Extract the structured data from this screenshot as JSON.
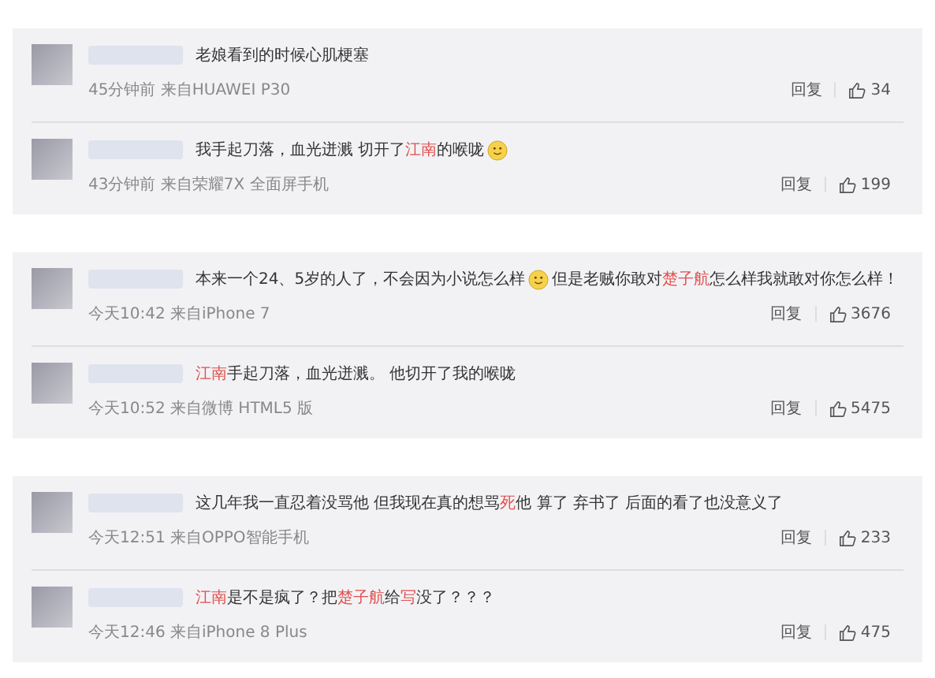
{
  "cards": [
    {
      "comments": [
        {
          "segments": [
            {
              "kind": "text",
              "text": "老娘看到的时候心肌梗塞"
            }
          ],
          "meta": "45分钟前 来自HUAWEI P30",
          "reply": "回复",
          "likes": "34"
        },
        {
          "segments": [
            {
              "kind": "text",
              "text": "我手起刀落，血光迸溅 切开了"
            },
            {
              "kind": "mention",
              "text": "江南"
            },
            {
              "kind": "text",
              "text": "的喉咙"
            },
            {
              "kind": "emoji"
            }
          ],
          "meta": "43分钟前 来自荣耀7X 全面屏手机",
          "reply": "回复",
          "likes": "199"
        }
      ]
    },
    {
      "comments": [
        {
          "segments": [
            {
              "kind": "text",
              "text": "本来一个24、5岁的人了，不会因为小说怎么样"
            },
            {
              "kind": "emoji"
            },
            {
              "kind": "text",
              "text": "但是老贼你敢对"
            },
            {
              "kind": "mention",
              "text": "楚子航"
            },
            {
              "kind": "text",
              "text": "怎么样我就敢对你怎么样！"
            }
          ],
          "meta": "今天10:42 来自iPhone 7",
          "reply": "回复",
          "likes": "3676"
        },
        {
          "segments": [
            {
              "kind": "mention",
              "text": "江南"
            },
            {
              "kind": "text",
              "text": "手起刀落，血光迸溅。 他切开了我的喉咙"
            }
          ],
          "meta": "今天10:52 来自微博 HTML5 版",
          "reply": "回复",
          "likes": "5475"
        }
      ]
    },
    {
      "comments": [
        {
          "segments": [
            {
              "kind": "text",
              "text": "这几年我一直忍着没骂他 但我现在真的想骂"
            },
            {
              "kind": "mention",
              "text": "死"
            },
            {
              "kind": "text",
              "text": "他 算了 弃书了 后面的看了也没意义了"
            }
          ],
          "meta": "今天12:51 来自OPPO智能手机",
          "reply": "回复",
          "likes": "233"
        },
        {
          "segments": [
            {
              "kind": "mention",
              "text": "江南"
            },
            {
              "kind": "text",
              "text": "是不是疯了？把"
            },
            {
              "kind": "mention",
              "text": "楚子航"
            },
            {
              "kind": "text",
              "text": "给"
            },
            {
              "kind": "mention",
              "text": "写"
            },
            {
              "kind": "text",
              "text": "没了？？？"
            }
          ],
          "meta": "今天12:46 来自iPhone 8 Plus",
          "reply": "回复",
          "likes": "475"
        }
      ]
    }
  ]
}
